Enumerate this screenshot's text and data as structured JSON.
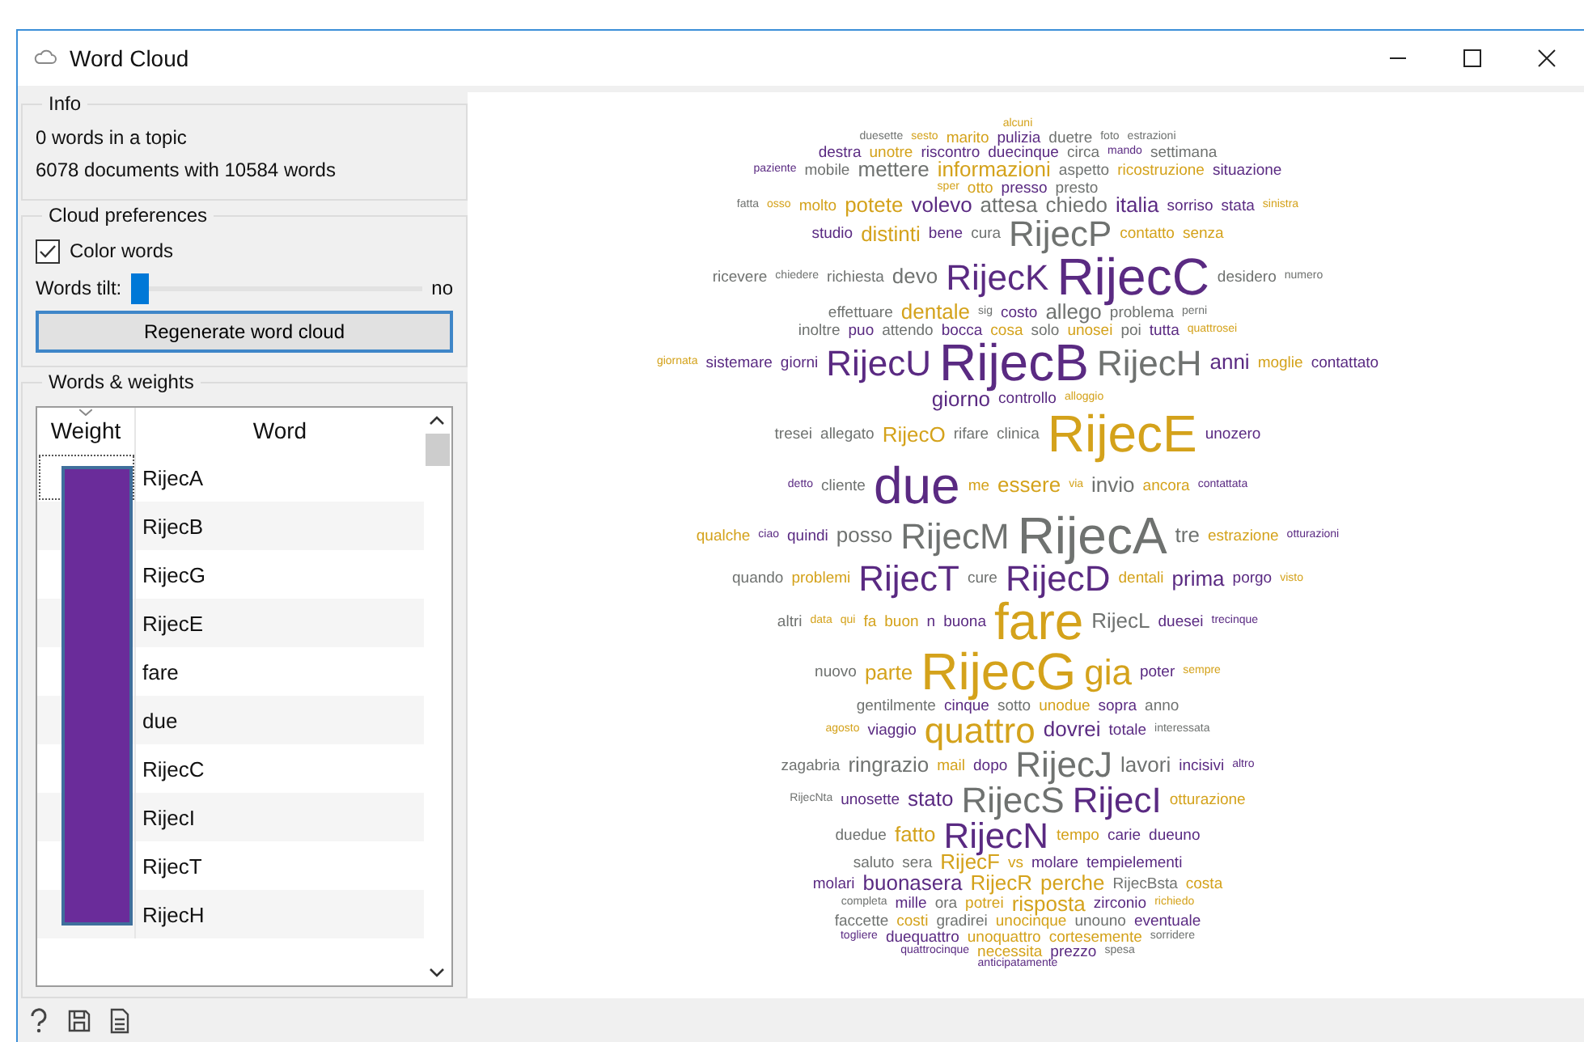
{
  "window": {
    "title": "Word Cloud"
  },
  "info": {
    "title": "Info",
    "lines": [
      "0 words in a topic",
      "6078 documents with 10584 words"
    ]
  },
  "preferences": {
    "title": "Cloud preferences",
    "color_words": {
      "label": "Color words",
      "checked": true
    },
    "tilt": {
      "label": "Words tilt:",
      "level": 0.0,
      "value": "no"
    },
    "regenerate_button": "Regenerate word cloud"
  },
  "words_weights": {
    "title": "Words & weights",
    "columns": [
      "Weight",
      "Word"
    ],
    "rows": [
      {
        "word": "RijecA",
        "focused": true
      },
      {
        "word": "RijecB",
        "focused": false
      },
      {
        "word": "RijecG",
        "focused": false
      },
      {
        "word": "RijecE",
        "focused": false
      },
      {
        "word": "fare",
        "focused": false
      },
      {
        "word": "due",
        "focused": false
      },
      {
        "word": "RijecC",
        "focused": false
      },
      {
        "word": "RijecI",
        "focused": false
      },
      {
        "word": "RijecT",
        "focused": false
      },
      {
        "word": "RijecH",
        "focused": false
      }
    ]
  },
  "cloud": {
    "rows": [
      {
        "words": [
          {
            "text": "alcuni",
            "color": "#d4a21b",
            "kind": "t"
          }
        ]
      },
      {
        "words": [
          {
            "text": "duesette",
            "color": "#6f7270",
            "kind": "t"
          },
          {
            "text": "sesto",
            "color": "#d4a21b",
            "kind": "t"
          },
          {
            "text": "marito",
            "color": "#d4a21b",
            "kind": "s"
          },
          {
            "text": "pulizia",
            "color": "#5a2a82",
            "kind": "s"
          },
          {
            "text": "duetre",
            "color": "#6f7270",
            "kind": "s"
          },
          {
            "text": "foto",
            "color": "#6f7270",
            "kind": "t"
          },
          {
            "text": "estrazioni",
            "color": "#6f7270",
            "kind": "t"
          }
        ]
      },
      {
        "words": [
          {
            "text": "destra",
            "color": "#5a2a82",
            "kind": "s"
          },
          {
            "text": "unotre",
            "color": "#d4a21b",
            "kind": "s"
          },
          {
            "text": "riscontro",
            "color": "#5a2a82",
            "kind": "s"
          },
          {
            "text": "duecinque",
            "color": "#5a2a82",
            "kind": "s"
          },
          {
            "text": "circa",
            "color": "#6f7270",
            "kind": "s"
          },
          {
            "text": "mando",
            "color": "#5a2a82",
            "kind": "t"
          },
          {
            "text": "settimana",
            "color": "#6f7270",
            "kind": "s"
          }
        ]
      },
      {
        "words": [
          {
            "text": "paziente",
            "color": "#5a2a82",
            "kind": "t"
          },
          {
            "text": "mobile",
            "color": "#6f7270",
            "kind": "s"
          },
          {
            "text": "mettere",
            "color": "#6f7270",
            "kind": "m"
          },
          {
            "text": "informazioni",
            "color": "#d4a21b",
            "kind": "m"
          },
          {
            "text": "aspetto",
            "color": "#6f7270",
            "kind": "s"
          },
          {
            "text": "ricostruzione",
            "color": "#d4a21b",
            "kind": "s"
          },
          {
            "text": "situazione",
            "color": "#5a2a82",
            "kind": "s"
          }
        ]
      },
      {
        "words": [
          {
            "text": "sper",
            "color": "#d4a21b",
            "kind": "t"
          },
          {
            "text": "otto",
            "color": "#d4a21b",
            "kind": "s"
          },
          {
            "text": "presso",
            "color": "#5a2a82",
            "kind": "s"
          },
          {
            "text": "presto",
            "color": "#6f7270",
            "kind": "s"
          }
        ]
      },
      {
        "words": [
          {
            "text": "fatta",
            "color": "#6f7270",
            "kind": "t"
          },
          {
            "text": "osso",
            "color": "#d4a21b",
            "kind": "t"
          },
          {
            "text": "molto",
            "color": "#d4a21b",
            "kind": "s"
          },
          {
            "text": "potete",
            "color": "#d4a21b",
            "kind": "m"
          },
          {
            "text": "volevo",
            "color": "#5a2a82",
            "kind": "m"
          },
          {
            "text": "attesa",
            "color": "#6f7270",
            "kind": "m"
          },
          {
            "text": "chiedo",
            "color": "#6f7270",
            "kind": "m"
          },
          {
            "text": "italia",
            "color": "#5a2a82",
            "kind": "m"
          },
          {
            "text": "sorriso",
            "color": "#5a2a82",
            "kind": "s"
          },
          {
            "text": "stata",
            "color": "#5a2a82",
            "kind": "s"
          },
          {
            "text": "sinistra",
            "color": "#d4a21b",
            "kind": "t"
          }
        ]
      },
      {
        "words": [
          {
            "text": "studio",
            "color": "#5a2a82",
            "kind": "s"
          },
          {
            "text": "distinti",
            "color": "#d4a21b",
            "kind": "m"
          },
          {
            "text": "bene",
            "color": "#5a2a82",
            "kind": "s"
          },
          {
            "text": "cura",
            "color": "#6f7270",
            "kind": "s"
          },
          {
            "text": "RijecP",
            "color": "#6f7270",
            "kind": "l"
          },
          {
            "text": "contatto",
            "color": "#d4a21b",
            "kind": "s"
          },
          {
            "text": "senza",
            "color": "#d4a21b",
            "kind": "s"
          }
        ]
      },
      {
        "words": [
          {
            "text": "ricevere",
            "color": "#6f7270",
            "kind": "s"
          },
          {
            "text": "chiedere",
            "color": "#6f7270",
            "kind": "t"
          },
          {
            "text": "richiesta",
            "color": "#6f7270",
            "kind": "s"
          },
          {
            "text": "devo",
            "color": "#6f7270",
            "kind": "m"
          },
          {
            "text": "RijecK",
            "color": "#5a2a82",
            "kind": "l"
          },
          {
            "text": "RijecC",
            "color": "#5a2a82",
            "kind": "xl"
          },
          {
            "text": "desidero",
            "color": "#6f7270",
            "kind": "s"
          },
          {
            "text": "numero",
            "color": "#6f7270",
            "kind": "t"
          }
        ]
      },
      {
        "words": [
          {
            "text": "effettuare",
            "color": "#6f7270",
            "kind": "s"
          },
          {
            "text": "dentale",
            "color": "#d4a21b",
            "kind": "m"
          },
          {
            "text": "sig",
            "color": "#6f7270",
            "kind": "t"
          },
          {
            "text": "costo",
            "color": "#5a2a82",
            "kind": "s"
          },
          {
            "text": "allego",
            "color": "#6f7270",
            "kind": "m"
          },
          {
            "text": "problema",
            "color": "#6f7270",
            "kind": "s"
          },
          {
            "text": "perni",
            "color": "#6f7270",
            "kind": "t"
          }
        ]
      },
      {
        "words": [
          {
            "text": "inoltre",
            "color": "#6f7270",
            "kind": "s"
          },
          {
            "text": "puo",
            "color": "#5a2a82",
            "kind": "s"
          },
          {
            "text": "attendo",
            "color": "#6f7270",
            "kind": "s"
          },
          {
            "text": "bocca",
            "color": "#5a2a82",
            "kind": "s"
          },
          {
            "text": "cosa",
            "color": "#d4a21b",
            "kind": "s"
          },
          {
            "text": "solo",
            "color": "#6f7270",
            "kind": "s"
          },
          {
            "text": "unosei",
            "color": "#d4a21b",
            "kind": "s"
          },
          {
            "text": "poi",
            "color": "#6f7270",
            "kind": "s"
          },
          {
            "text": "tutta",
            "color": "#5a2a82",
            "kind": "s"
          },
          {
            "text": "quattrosei",
            "color": "#d4a21b",
            "kind": "t"
          }
        ]
      },
      {
        "words": [
          {
            "text": "giornata",
            "color": "#d4a21b",
            "kind": "t"
          },
          {
            "text": "sistemare",
            "color": "#5a2a82",
            "kind": "s"
          },
          {
            "text": "giorni",
            "color": "#5a2a82",
            "kind": "s"
          },
          {
            "text": "RijecU",
            "color": "#5a2a82",
            "kind": "l"
          },
          {
            "text": "RijecB",
            "color": "#5a2a82",
            "kind": "xl"
          },
          {
            "text": "RijecH",
            "color": "#6f7270",
            "kind": "l"
          },
          {
            "text": "anni",
            "color": "#5a2a82",
            "kind": "m"
          },
          {
            "text": "moglie",
            "color": "#d4a21b",
            "kind": "s"
          },
          {
            "text": "contattato",
            "color": "#5a2a82",
            "kind": "s"
          }
        ]
      },
      {
        "words": [
          {
            "text": "giorno",
            "color": "#5a2a82",
            "kind": "m"
          },
          {
            "text": "controllo",
            "color": "#5a2a82",
            "kind": "s"
          },
          {
            "text": "alloggio",
            "color": "#d4a21b",
            "kind": "t"
          }
        ]
      },
      {
        "words": [
          {
            "text": "tresei",
            "color": "#6f7270",
            "kind": "s"
          },
          {
            "text": "allegato",
            "color": "#6f7270",
            "kind": "s"
          },
          {
            "text": "RijecO",
            "color": "#d4a21b",
            "kind": "m"
          },
          {
            "text": "rifare",
            "color": "#6f7270",
            "kind": "s"
          },
          {
            "text": "clinica",
            "color": "#6f7270",
            "kind": "s"
          },
          {
            "text": "RijecE",
            "color": "#d4a21b",
            "kind": "xl"
          },
          {
            "text": "unozero",
            "color": "#5a2a82",
            "kind": "s"
          }
        ]
      },
      {
        "words": [
          {
            "text": "detto",
            "color": "#5a2a82",
            "kind": "t"
          },
          {
            "text": "cliente",
            "color": "#6f7270",
            "kind": "s"
          },
          {
            "text": "due",
            "color": "#5a2a82",
            "kind": "xl"
          },
          {
            "text": "me",
            "color": "#d4a21b",
            "kind": "s"
          },
          {
            "text": "essere",
            "color": "#d4a21b",
            "kind": "m"
          },
          {
            "text": "via",
            "color": "#d4a21b",
            "kind": "t"
          },
          {
            "text": "invio",
            "color": "#6f7270",
            "kind": "m"
          },
          {
            "text": "ancora",
            "color": "#d4a21b",
            "kind": "s"
          },
          {
            "text": "contattata",
            "color": "#5a2a82",
            "kind": "t"
          }
        ]
      },
      {
        "words": [
          {
            "text": "qualche",
            "color": "#d4a21b",
            "kind": "s"
          },
          {
            "text": "ciao",
            "color": "#5a2a82",
            "kind": "t"
          },
          {
            "text": "quindi",
            "color": "#5a2a82",
            "kind": "s"
          },
          {
            "text": "posso",
            "color": "#6f7270",
            "kind": "m"
          },
          {
            "text": "RijecM",
            "color": "#6f7270",
            "kind": "l"
          },
          {
            "text": "RijecA",
            "color": "#6f7270",
            "kind": "xl"
          },
          {
            "text": "tre",
            "color": "#6f7270",
            "kind": "m"
          },
          {
            "text": "estrazione",
            "color": "#d4a21b",
            "kind": "s"
          },
          {
            "text": "otturazioni",
            "color": "#5a2a82",
            "kind": "t"
          }
        ]
      },
      {
        "words": [
          {
            "text": "quando",
            "color": "#6f7270",
            "kind": "s"
          },
          {
            "text": "problemi",
            "color": "#d4a21b",
            "kind": "s"
          },
          {
            "text": "RijecT",
            "color": "#5a2a82",
            "kind": "l"
          },
          {
            "text": "cure",
            "color": "#6f7270",
            "kind": "s"
          },
          {
            "text": "RijecD",
            "color": "#5a2a82",
            "kind": "l"
          },
          {
            "text": "dentali",
            "color": "#d4a21b",
            "kind": "s"
          },
          {
            "text": "prima",
            "color": "#5a2a82",
            "kind": "m"
          },
          {
            "text": "porgo",
            "color": "#5a2a82",
            "kind": "s"
          },
          {
            "text": "visto",
            "color": "#d4a21b",
            "kind": "t"
          }
        ]
      },
      {
        "words": [
          {
            "text": "altri",
            "color": "#6f7270",
            "kind": "s"
          },
          {
            "text": "data",
            "color": "#d4a21b",
            "kind": "t"
          },
          {
            "text": "qui",
            "color": "#d4a21b",
            "kind": "t"
          },
          {
            "text": "fa",
            "color": "#d4a21b",
            "kind": "s"
          },
          {
            "text": "buon",
            "color": "#d4a21b",
            "kind": "s"
          },
          {
            "text": "n",
            "color": "#5a2a82",
            "kind": "s"
          },
          {
            "text": "buona",
            "color": "#5a2a82",
            "kind": "s"
          },
          {
            "text": "fare",
            "color": "#d4a21b",
            "kind": "xl"
          },
          {
            "text": "RijecL",
            "color": "#6f7270",
            "kind": "m"
          },
          {
            "text": "duesei",
            "color": "#5a2a82",
            "kind": "s"
          },
          {
            "text": "trecinque",
            "color": "#5a2a82",
            "kind": "t"
          }
        ]
      },
      {
        "words": [
          {
            "text": "nuovo",
            "color": "#6f7270",
            "kind": "s"
          },
          {
            "text": "parte",
            "color": "#d4a21b",
            "kind": "m"
          },
          {
            "text": "RijecG",
            "color": "#d4a21b",
            "kind": "xl"
          },
          {
            "text": "gia",
            "color": "#d4a21b",
            "kind": "l"
          },
          {
            "text": "poter",
            "color": "#5a2a82",
            "kind": "s"
          },
          {
            "text": "sempre",
            "color": "#d4a21b",
            "kind": "t"
          }
        ]
      },
      {
        "words": [
          {
            "text": "gentilmente",
            "color": "#6f7270",
            "kind": "s"
          },
          {
            "text": "cinque",
            "color": "#5a2a82",
            "kind": "s"
          },
          {
            "text": "sotto",
            "color": "#6f7270",
            "kind": "s"
          },
          {
            "text": "unodue",
            "color": "#d4a21b",
            "kind": "s"
          },
          {
            "text": "sopra",
            "color": "#5a2a82",
            "kind": "s"
          },
          {
            "text": "anno",
            "color": "#6f7270",
            "kind": "s"
          }
        ]
      },
      {
        "words": [
          {
            "text": "agosto",
            "color": "#d4a21b",
            "kind": "t"
          },
          {
            "text": "viaggio",
            "color": "#5a2a82",
            "kind": "s"
          },
          {
            "text": "quattro",
            "color": "#d4a21b",
            "kind": "l"
          },
          {
            "text": "dovrei",
            "color": "#5a2a82",
            "kind": "m"
          },
          {
            "text": "totale",
            "color": "#5a2a82",
            "kind": "s"
          },
          {
            "text": "interessata",
            "color": "#6f7270",
            "kind": "t"
          }
        ]
      },
      {
        "words": [
          {
            "text": "zagabria",
            "color": "#6f7270",
            "kind": "s"
          },
          {
            "text": "ringrazio",
            "color": "#6f7270",
            "kind": "m"
          },
          {
            "text": "mail",
            "color": "#d4a21b",
            "kind": "s"
          },
          {
            "text": "dopo",
            "color": "#5a2a82",
            "kind": "s"
          },
          {
            "text": "RijecJ",
            "color": "#6f7270",
            "kind": "l"
          },
          {
            "text": "lavori",
            "color": "#6f7270",
            "kind": "m"
          },
          {
            "text": "incisivi",
            "color": "#5a2a82",
            "kind": "s"
          },
          {
            "text": "altro",
            "color": "#5a2a82",
            "kind": "t"
          }
        ]
      },
      {
        "words": [
          {
            "text": "RijecNta",
            "color": "#6f7270",
            "kind": "t"
          },
          {
            "text": "unosette",
            "color": "#5a2a82",
            "kind": "s"
          },
          {
            "text": "stato",
            "color": "#5a2a82",
            "kind": "m"
          },
          {
            "text": "RijecS",
            "color": "#6f7270",
            "kind": "l"
          },
          {
            "text": "RijecI",
            "color": "#5a2a82",
            "kind": "l"
          },
          {
            "text": "otturazione",
            "color": "#d4a21b",
            "kind": "s"
          }
        ]
      },
      {
        "words": [
          {
            "text": "duedue",
            "color": "#6f7270",
            "kind": "s"
          },
          {
            "text": "fatto",
            "color": "#d4a21b",
            "kind": "m"
          },
          {
            "text": "RijecN",
            "color": "#5a2a82",
            "kind": "l"
          },
          {
            "text": "tempo",
            "color": "#d4a21b",
            "kind": "s"
          },
          {
            "text": "carie",
            "color": "#5a2a82",
            "kind": "s"
          },
          {
            "text": "dueuno",
            "color": "#5a2a82",
            "kind": "s"
          }
        ]
      },
      {
        "words": [
          {
            "text": "saluto",
            "color": "#6f7270",
            "kind": "s"
          },
          {
            "text": "sera",
            "color": "#6f7270",
            "kind": "s"
          },
          {
            "text": "RijecF",
            "color": "#d4a21b",
            "kind": "m"
          },
          {
            "text": "vs",
            "color": "#d4a21b",
            "kind": "s"
          },
          {
            "text": "molare",
            "color": "#5a2a82",
            "kind": "s"
          },
          {
            "text": "tempielementi",
            "color": "#5a2a82",
            "kind": "s"
          }
        ]
      },
      {
        "words": [
          {
            "text": "molari",
            "color": "#5a2a82",
            "kind": "s"
          },
          {
            "text": "buonasera",
            "color": "#5a2a82",
            "kind": "m"
          },
          {
            "text": "RijecR",
            "color": "#d4a21b",
            "kind": "m"
          },
          {
            "text": "perche",
            "color": "#d4a21b",
            "kind": "m"
          },
          {
            "text": "RijecBsta",
            "color": "#6f7270",
            "kind": "s"
          },
          {
            "text": "costa",
            "color": "#d4a21b",
            "kind": "s"
          }
        ]
      },
      {
        "words": [
          {
            "text": "completa",
            "color": "#6f7270",
            "kind": "t"
          },
          {
            "text": "mille",
            "color": "#5a2a82",
            "kind": "s"
          },
          {
            "text": "ora",
            "color": "#6f7270",
            "kind": "s"
          },
          {
            "text": "potrei",
            "color": "#d4a21b",
            "kind": "s"
          },
          {
            "text": "risposta",
            "color": "#d4a21b",
            "kind": "m"
          },
          {
            "text": "zirconio",
            "color": "#5a2a82",
            "kind": "s"
          },
          {
            "text": "richiedo",
            "color": "#d4a21b",
            "kind": "t"
          }
        ]
      },
      {
        "words": [
          {
            "text": "faccette",
            "color": "#6f7270",
            "kind": "s"
          },
          {
            "text": "costi",
            "color": "#d4a21b",
            "kind": "s"
          },
          {
            "text": "gradirei",
            "color": "#6f7270",
            "kind": "s"
          },
          {
            "text": "unocinque",
            "color": "#d4a21b",
            "kind": "s"
          },
          {
            "text": "unouno",
            "color": "#6f7270",
            "kind": "s"
          },
          {
            "text": "eventuale",
            "color": "#5a2a82",
            "kind": "s"
          }
        ]
      },
      {
        "words": [
          {
            "text": "togliere",
            "color": "#5a2a82",
            "kind": "t"
          },
          {
            "text": "duequattro",
            "color": "#5a2a82",
            "kind": "s"
          },
          {
            "text": "unoquattro",
            "color": "#d4a21b",
            "kind": "s"
          },
          {
            "text": "cortesemente",
            "color": "#d4a21b",
            "kind": "s"
          },
          {
            "text": "sorridere",
            "color": "#6f7270",
            "kind": "t"
          }
        ]
      },
      {
        "words": [
          {
            "text": "quattrocinque",
            "color": "#5a2a82",
            "kind": "t"
          },
          {
            "text": "necessita",
            "color": "#d4a21b",
            "kind": "s"
          },
          {
            "text": "prezzo",
            "color": "#5a2a82",
            "kind": "s"
          },
          {
            "text": "spesa",
            "color": "#6f7270",
            "kind": "t"
          }
        ]
      },
      {
        "words": [
          {
            "text": "anticipatamente",
            "color": "#5a2a82",
            "kind": "t"
          }
        ]
      }
    ]
  }
}
